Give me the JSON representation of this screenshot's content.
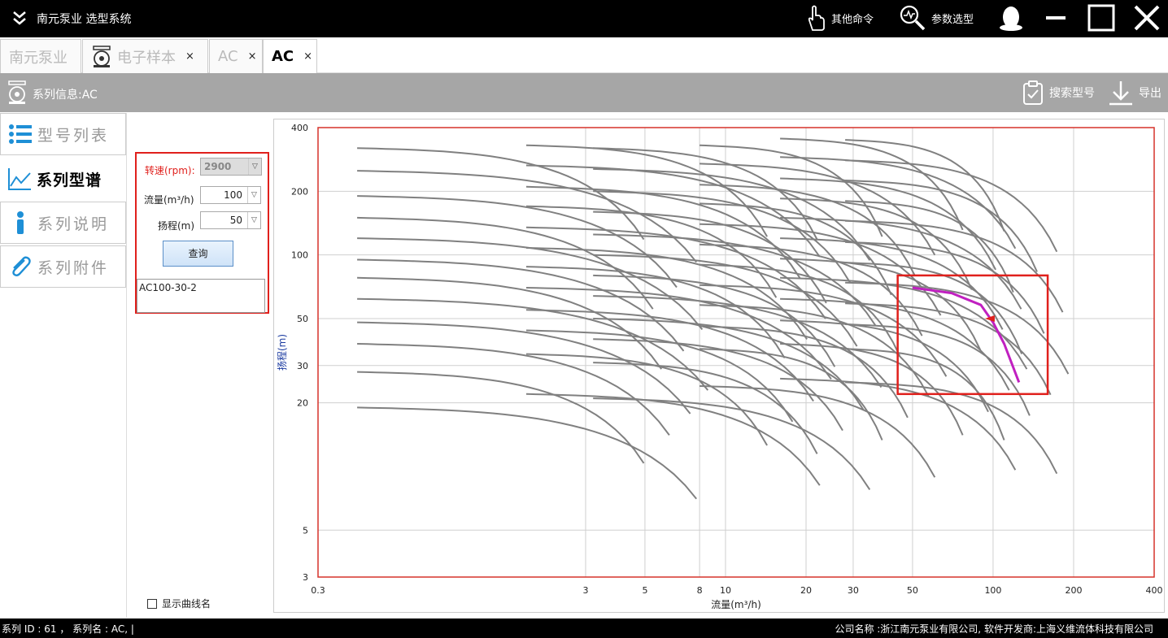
{
  "titlebar": {
    "app_title": "南元泵业 选型系统",
    "other_commands": "其他命令",
    "param_selection": "参数选型"
  },
  "tabs": [
    {
      "label": "南元泵业",
      "closable": false
    },
    {
      "label": "电子样本",
      "closable": true
    },
    {
      "label": "AC",
      "closable": true
    },
    {
      "label": "AC",
      "closable": true,
      "active": true
    }
  ],
  "tab_close_glyph": "×",
  "infobar": {
    "series_info": "系列信息:AC",
    "search_model": "搜索型号",
    "export": "导出"
  },
  "nav": [
    {
      "label": "型号列表",
      "icon": "list-icon"
    },
    {
      "label": "系列型谱",
      "icon": "chart-line-icon",
      "active": true
    },
    {
      "label": "系列说明",
      "icon": "info-icon"
    },
    {
      "label": "系列附件",
      "icon": "paperclip-icon"
    }
  ],
  "query": {
    "speed_label": "转速(rpm):",
    "speed_value": "2900",
    "flow_label": "流量(m³/h)",
    "flow_value": "100",
    "head_label": "扬程(m)",
    "head_value": "50",
    "query_button": "查询",
    "results": [
      "AC100-30-2"
    ],
    "show_curve_names": "显示曲线名"
  },
  "chart_data": {
    "type": "line",
    "xlabel": "流量(m³/h)",
    "ylabel": "扬程(m)",
    "x_scale": "log",
    "y_scale": "log",
    "xlim": [
      0.3,
      400
    ],
    "ylim": [
      3,
      400
    ],
    "x_ticks": [
      "0.3",
      "3",
      "5",
      "8",
      "10",
      "20",
      "30",
      "50",
      "100",
      "200",
      "400"
    ],
    "y_ticks": [
      "400",
      "200",
      "100",
      "50",
      "30",
      "20",
      "5",
      "3"
    ],
    "grid": true,
    "curve_color": "#808080",
    "highlight": {
      "name": "AC100-30-2",
      "color": "#c020c0",
      "points": [
        [
          50,
          70
        ],
        [
          70,
          66
        ],
        [
          90,
          58
        ],
        [
          100,
          48
        ],
        [
          110,
          38
        ],
        [
          125,
          25
        ]
      ],
      "operating_point": [
        100,
        50
      ],
      "box": {
        "x": [
          44,
          160
        ],
        "y": [
          22,
          80
        ]
      }
    },
    "series_summary": "multiple gray pump head-flow curves across the full flow range"
  },
  "status": {
    "left": "系列 ID : 61    ，  系列名 : AC,       |",
    "right": "公司名称 :浙江南元泵业有限公司,     软件开发商:上海义维流体科技有限公司"
  }
}
